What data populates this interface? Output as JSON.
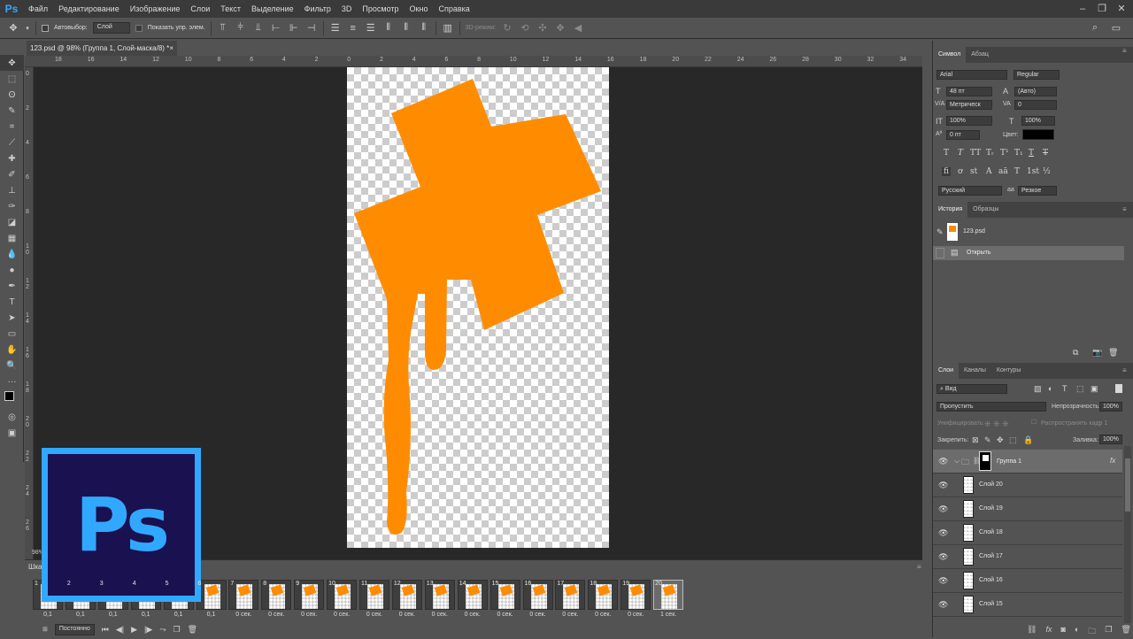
{
  "app": {
    "logo": "Ps"
  },
  "menu": [
    "Файл",
    "Редактирование",
    "Изображение",
    "Слои",
    "Текст",
    "Выделение",
    "Фильтр",
    "3D",
    "Просмотр",
    "Окно",
    "Справка"
  ],
  "window_controls": {
    "minimize": "–",
    "maximize": "❐",
    "close": "✕"
  },
  "options_bar": {
    "autoselect_label": "Автовыбор:",
    "autoselect_value": "Слой",
    "show_transform_label": "Показать упр. элем.",
    "mode_3d_label": "3D-режим:"
  },
  "document": {
    "tab_title": "123.psd @ 98% (Группа 1, Слой-маска/8) *",
    "zoom": "98%"
  },
  "ruler": {
    "top_ticks": [
      "18",
      "16",
      "14",
      "12",
      "10",
      "8",
      "6",
      "4",
      "2",
      "0",
      "2",
      "4",
      "6",
      "8",
      "10",
      "12",
      "14",
      "16",
      "18",
      "20",
      "22",
      "24",
      "26",
      "28",
      "30",
      "32",
      "34"
    ],
    "left_ticks": [
      "0",
      "2",
      "4",
      "6",
      "8",
      "1 0",
      "1 2",
      "1 4",
      "1 6",
      "1 8",
      "2 0",
      "2 2",
      "2 4",
      "2 6"
    ]
  },
  "timeline": {
    "title": "Шкала времени",
    "loop": "Постоянно",
    "frames": [
      {
        "num": "1",
        "delay": "0,1"
      },
      {
        "num": "2",
        "delay": "0,1"
      },
      {
        "num": "3",
        "delay": "0,1"
      },
      {
        "num": "4",
        "delay": "0,1"
      },
      {
        "num": "5",
        "delay": "0,1"
      },
      {
        "num": "6",
        "delay": "0,1"
      },
      {
        "num": "7",
        "delay": "0 сек."
      },
      {
        "num": "8",
        "delay": "0 сек."
      },
      {
        "num": "9",
        "delay": "0 сек."
      },
      {
        "num": "10",
        "delay": "0 сек."
      },
      {
        "num": "11",
        "delay": "0 сек."
      },
      {
        "num": "12",
        "delay": "0 сек."
      },
      {
        "num": "13",
        "delay": "0 сек."
      },
      {
        "num": "14",
        "delay": "0 сек."
      },
      {
        "num": "15",
        "delay": "0 сек."
      },
      {
        "num": "16",
        "delay": "0 сек."
      },
      {
        "num": "17",
        "delay": "0 сек."
      },
      {
        "num": "18",
        "delay": "0 сек."
      },
      {
        "num": "19",
        "delay": "0 сек."
      },
      {
        "num": "20",
        "delay": "1 сек."
      }
    ]
  },
  "badge": {
    "text": "Ps"
  },
  "character_panel": {
    "tabs": [
      "Символ",
      "Абзац"
    ],
    "font_family": "Arial",
    "font_style": "Regular",
    "font_size": "48 пт",
    "leading": "(Авто)",
    "kerning": "Метрическ",
    "tracking": "0",
    "vscale": "100%",
    "hscale": "100%",
    "baseline": "0 пт",
    "color_label": "Цвет:",
    "language": "Русский",
    "antialias": "Резкое",
    "style_buttons_row1": [
      "T",
      "T",
      "TT",
      "Tᵣ",
      "T¹",
      "T₁",
      "T",
      "T"
    ],
    "style_buttons_row2": [
      "fi",
      "ơ",
      "st",
      "A",
      "aā",
      "T",
      "1st",
      "½"
    ]
  },
  "history_panel": {
    "tabs": [
      "История",
      "Образцы"
    ],
    "snapshot": "123.psd",
    "items": [
      "Открыть"
    ]
  },
  "layers_panel": {
    "tabs": [
      "Слои",
      "Каналы",
      "Контуры"
    ],
    "filter": "Вид",
    "blend_mode": "Пропустить",
    "opacity_label": "Непрозрачность:",
    "opacity": "100%",
    "unify_label": "Унифицировать:",
    "propagate_label": "Распространять кадр 1",
    "lock_label": "Закрепить:",
    "fill_label": "Заливка:",
    "fill": "100%",
    "group": "Группа 1",
    "layers": [
      "Слой 20",
      "Слой 19",
      "Слой 18",
      "Слой 17",
      "Слой 16",
      "Слой 15"
    ]
  },
  "colors": {
    "accent": "#31a8ff",
    "badge_bg": "#1a1151",
    "shape": "#ff8c00"
  }
}
